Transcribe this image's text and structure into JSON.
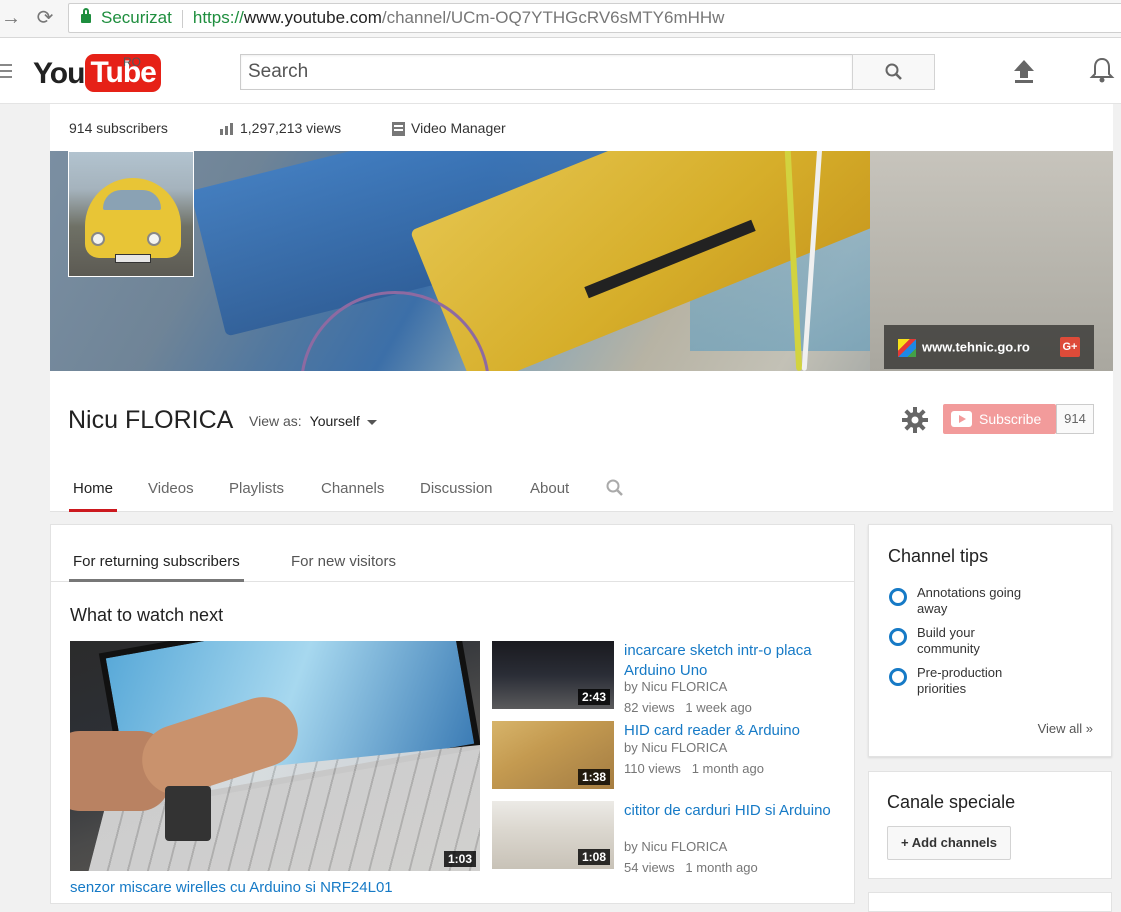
{
  "browser": {
    "secure_label": "Securizat",
    "url_proto": "https://",
    "url_host": "www.youtube.com",
    "url_path": "/channel/UCm-OQ7YTHGcRV6sMTY6mHHw"
  },
  "masthead": {
    "logo_you": "You",
    "logo_tube": "Tube",
    "region": "RO",
    "search_placeholder": "Search"
  },
  "stats": {
    "subscribers": "914 subscribers",
    "views": "1,297,213 views",
    "video_manager": "Video Manager"
  },
  "banner": {
    "website": "www.tehnic.go.ro",
    "gplus": "G+"
  },
  "channel": {
    "name": "Nicu FLORICA",
    "view_as_label": "View as:",
    "view_as_value": "Yourself",
    "subscribe_label": "Subscribe",
    "subscriber_count": "914"
  },
  "tabs": [
    "Home",
    "Videos",
    "Playlists",
    "Channels",
    "Discussion",
    "About"
  ],
  "subtabs": [
    "For returning subscribers",
    "For new visitors"
  ],
  "section_title": "What to watch next",
  "featured": {
    "title": "senzor miscare wirelles cu Arduino si NRF24L01",
    "duration": "1:03"
  },
  "videos": [
    {
      "title": "incarcare sketch intr-o placa Arduino Uno",
      "by": "by Nicu FLORICA",
      "views": "82 views",
      "age": "1 week ago",
      "duration": "2:43"
    },
    {
      "title": "HID card reader & Arduino",
      "by": "by Nicu FLORICA",
      "views": "110 views",
      "age": "1 month ago",
      "duration": "1:38"
    },
    {
      "title": "cititor de carduri HID si Arduino",
      "by": "by Nicu FLORICA",
      "views": "54 views",
      "age": "1 month ago",
      "duration": "1:08"
    }
  ],
  "tips": {
    "title": "Channel tips",
    "items": [
      "Annotations going away",
      "Build your community",
      "Pre-production priorities"
    ],
    "view_all": "View all »"
  },
  "special": {
    "title": "Canale speciale",
    "add_label": "+ Add channels"
  },
  "colors": {
    "accent_red": "#cc181e",
    "link_blue": "#167ac6",
    "secure_green": "#1e8e3e"
  }
}
